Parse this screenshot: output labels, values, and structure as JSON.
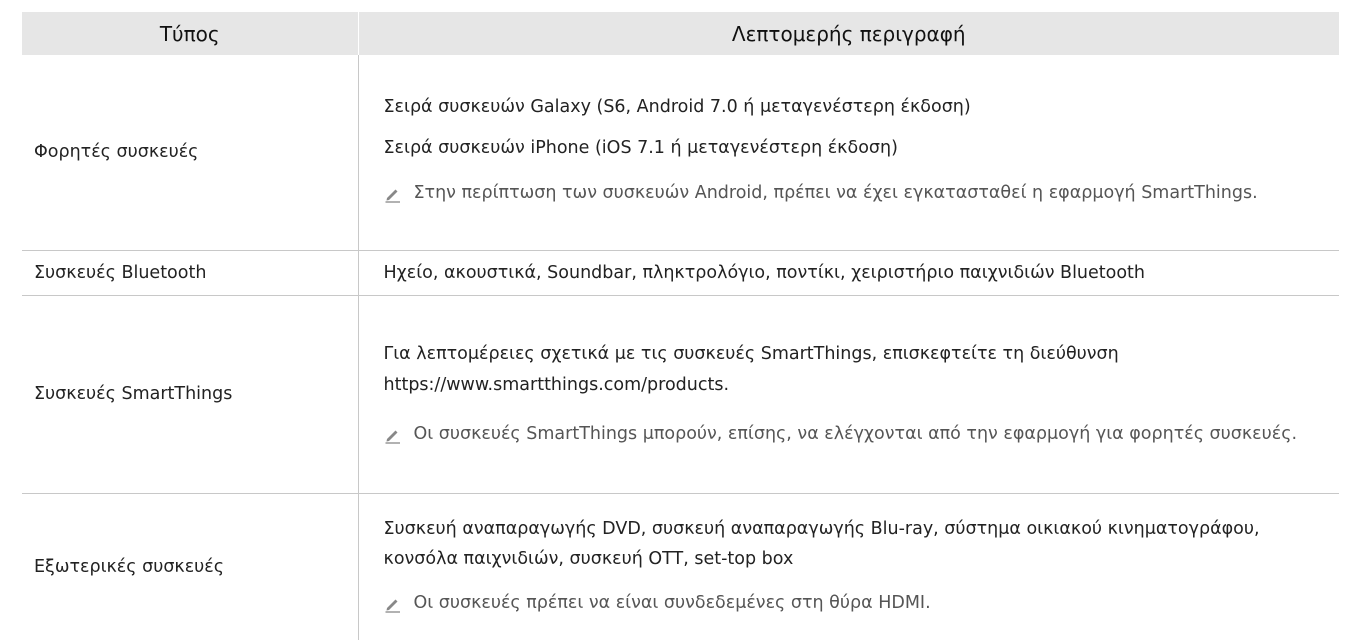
{
  "table": {
    "headers": [
      "Τύπος",
      "Λεπτομερής περιγραφή"
    ],
    "rows": [
      {
        "type": "Φορητές συσκευές",
        "lines": [
          "Σειρά συσκευών Galaxy (S6, Android 7.0 ή μεταγενέστερη έκδοση)",
          "Σειρά συσκευών iPhone (iOS 7.1 ή μεταγενέστερη έκδοση)"
        ],
        "note": "Στην περίπτωση των συσκευών Android, πρέπει να έχει εγκατασταθεί η εφαρμογή SmartThings."
      },
      {
        "type": "Συσκευές Bluetooth",
        "lines": [
          "Ηχείο, ακουστικά, Soundbar, πληκτρολόγιο, ποντίκι, χειριστήριο παιχνιδιών Bluetooth"
        ]
      },
      {
        "type": "Συσκευές SmartThings",
        "lines": [
          "Για λεπτομέρειες σχετικά με τις συσκευές SmartThings, επισκεφτείτε τη διεύθυνση https://www.smartthings.com/products."
        ],
        "note": "Οι συσκευές SmartThings μπορούν, επίσης, να ελέγχονται από την εφαρμογή για φορητές συσκευές."
      },
      {
        "type": "Εξωτερικές συσκευές",
        "lines": [
          "Συσκευή αναπαραγωγής DVD, συσκευή αναπαραγωγής Blu-ray, σύστημα οικιακού κινηματογράφου, κονσόλα παιχνιδιών, συσκευή OTT, set-top box"
        ],
        "note": "Οι συσκευές πρέπει να είναι συνδεδεμένες στη θύρα HDMI."
      }
    ]
  },
  "icons": {
    "note": "pencil-note-icon"
  },
  "colors": {
    "header_bg": "#e6e6e6",
    "border": "#c8c8c8",
    "note_text": "#555555"
  }
}
